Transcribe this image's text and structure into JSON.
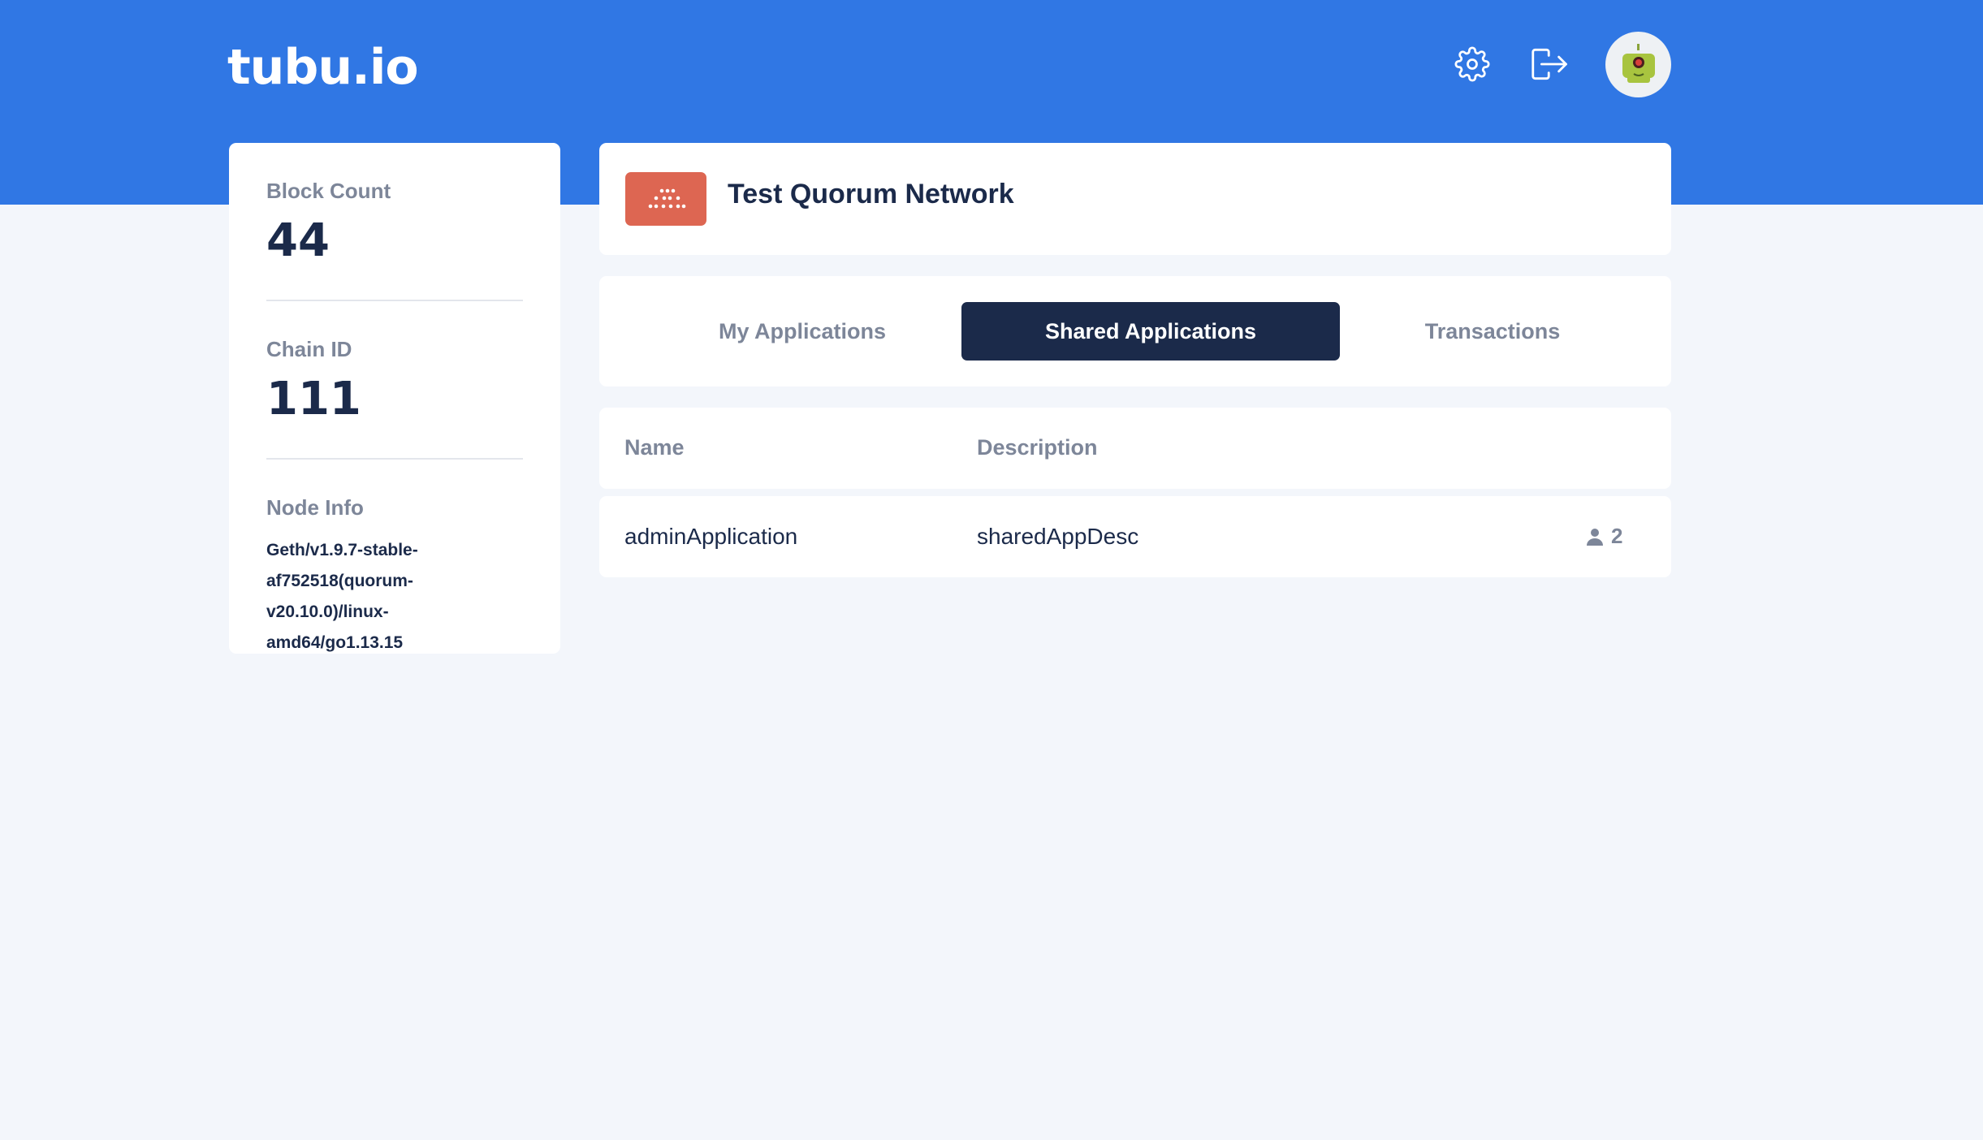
{
  "header": {
    "logo": "tubu.io",
    "icons": [
      "gear-icon",
      "logout-icon"
    ],
    "avatar": "avatar-robot"
  },
  "stats": {
    "block_count_label": "Block Count",
    "block_count_value": "44",
    "chain_id_label": "Chain ID",
    "chain_id_value": "111",
    "node_info_label": "Node Info",
    "node_info_value": "Geth/v1.9.7-stable-af752518(quorum-v20.10.0)/linux-amd64/go1.13.15"
  },
  "network": {
    "title": "Test Quorum Network",
    "badge_color": "#dd6652"
  },
  "tabs": [
    {
      "label": "My Applications",
      "active": false
    },
    {
      "label": "Shared Applications",
      "active": true
    },
    {
      "label": "Transactions",
      "active": false
    }
  ],
  "table": {
    "columns": [
      "Name",
      "Description"
    ],
    "rows": [
      {
        "name": "adminApplication",
        "description": "sharedAppDesc",
        "members": "2"
      }
    ]
  },
  "colors": {
    "brand": "#3077e4",
    "navy": "#1b2a4a",
    "muted": "#7d8699",
    "background": "#f3f6fb"
  }
}
